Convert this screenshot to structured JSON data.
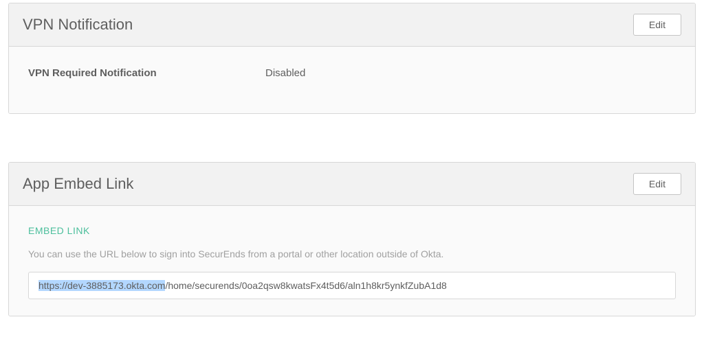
{
  "vpn_panel": {
    "title": "VPN Notification",
    "edit_label": "Edit",
    "field_label": "VPN Required Notification",
    "field_value": "Disabled"
  },
  "embed_panel": {
    "title": "App Embed Link",
    "edit_label": "Edit",
    "section_label": "EMBED LINK",
    "description": "You can use the URL below to sign into SecurEnds from a portal or other location outside of Okta.",
    "url_highlighted": "https://dev-3885173.okta.com",
    "url_rest": "/home/securends/0oa2qsw8kwatsFx4t5d6/aln1h8kr5ynkfZubA1d8"
  }
}
